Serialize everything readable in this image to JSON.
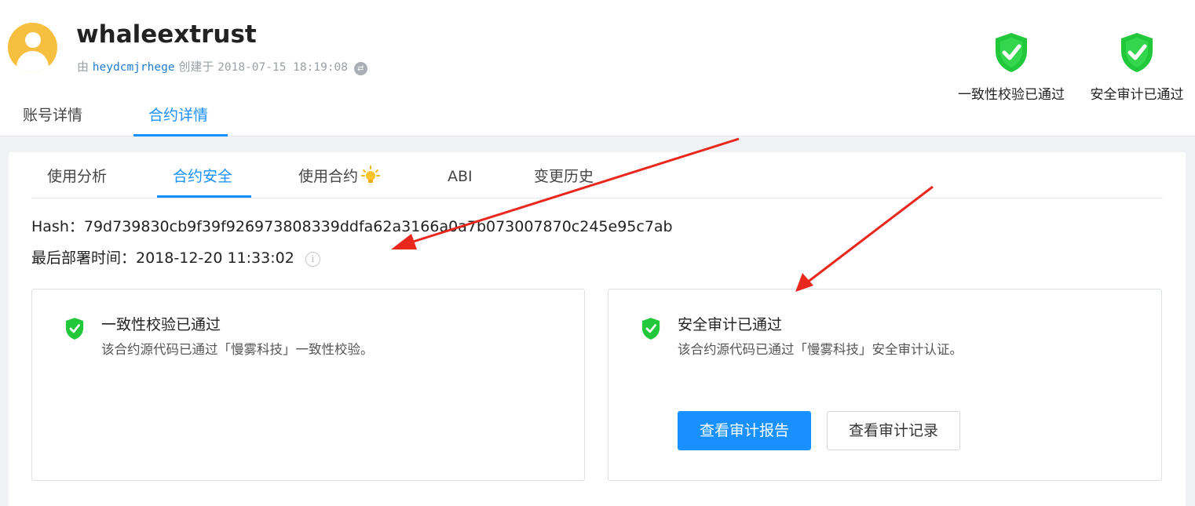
{
  "account": {
    "name": "whaleextrust",
    "by_label": "由",
    "creator": "heydcmjrhege",
    "created_label": "创建于",
    "created_time": "2018-07-15 18:19:08",
    "swap_icon": "swap-icon"
  },
  "badges": [
    {
      "label": "一致性校验已通过",
      "icon": "shield-check-icon",
      "color": "#21c93a"
    },
    {
      "label": "安全审计已通过",
      "icon": "shield-check-icon",
      "color": "#21c93a"
    }
  ],
  "top_tabs": [
    {
      "label": "账号详情",
      "active": false
    },
    {
      "label": "合约详情",
      "active": true
    }
  ],
  "sub_tabs": [
    {
      "label": "使用分析",
      "active": false
    },
    {
      "label": "合约安全",
      "active": true
    },
    {
      "label": "使用合约",
      "active": false,
      "icon": "bulb-icon"
    },
    {
      "label": "ABI",
      "active": false
    },
    {
      "label": "变更历史",
      "active": false
    }
  ],
  "contract": {
    "hash_label": "Hash：",
    "hash": "79d739830cb9f39f926973808339ddfa62a3166a0a7b073007870c245e95c7ab",
    "deploy_label": "最后部署时间：",
    "deploy_time": "2018-12-20 11:33:02",
    "info_icon": "info-icon"
  },
  "consistency": {
    "title": "一致性校验已通过",
    "desc": "该合约源代码已通过「慢雾科技」一致性校验。"
  },
  "audit": {
    "title": "安全审计已通过",
    "desc": "该合约源代码已通过「慢雾科技」安全审计认证。",
    "report_button": "查看审计报告",
    "records_button": "查看审计记录"
  },
  "colors": {
    "accent": "#1890ff",
    "shield_green": "#21c93a",
    "avatar": "#f7bf3f",
    "annotation_arrow": "#e8281c"
  }
}
